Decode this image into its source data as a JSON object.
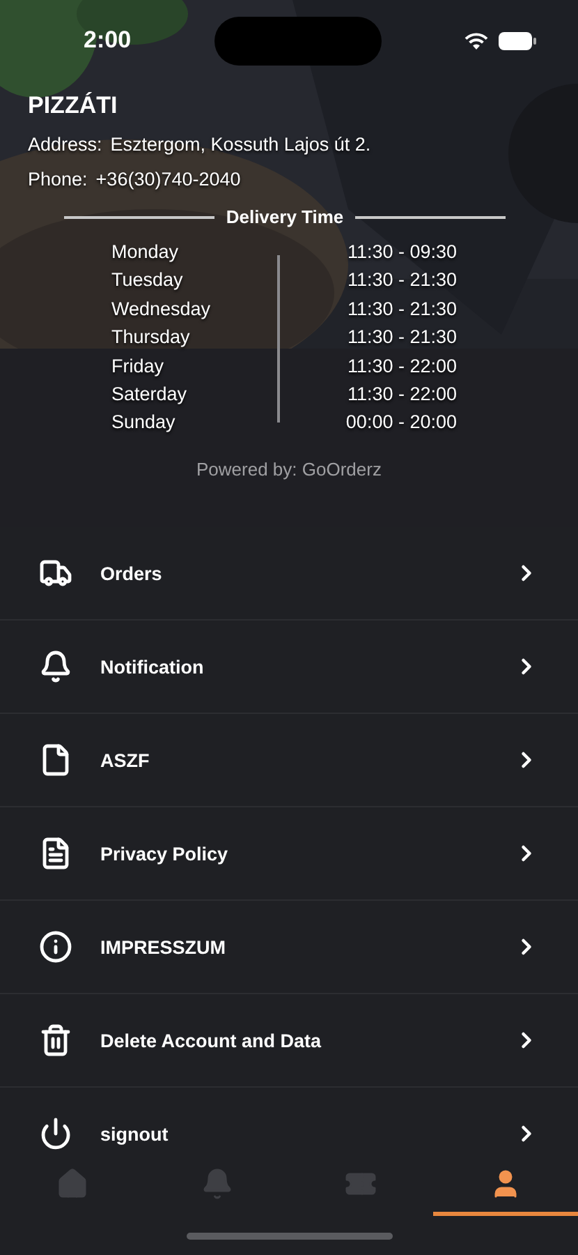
{
  "status_bar": {
    "time": "2:00"
  },
  "restaurant": {
    "name": "PIZZÁTI",
    "address_label": "Address:",
    "address": "Esztergom, Kossuth Lajos út 2.",
    "phone_label": "Phone:",
    "phone": "+36(30)740-2040"
  },
  "delivery": {
    "title": "Delivery Time",
    "days": [
      {
        "day": "Monday",
        "hours": "11:30 - 09:30"
      },
      {
        "day": "Tuesday",
        "hours": "11:30 - 21:30"
      },
      {
        "day": "Wednesday",
        "hours": "11:30 - 21:30"
      },
      {
        "day": "Thursday",
        "hours": "11:30 - 21:30"
      },
      {
        "day": "Friday",
        "hours": "11:30 - 22:00"
      },
      {
        "day": "Saterday",
        "hours": "11:30 - 22:00"
      },
      {
        "day": "Sunday",
        "hours": "00:00 - 20:00"
      }
    ]
  },
  "powered_by": "Powered by: GoOrderz",
  "menu": [
    {
      "kind": "orders",
      "label": "Orders"
    },
    {
      "kind": "notification",
      "label": "Notification"
    },
    {
      "kind": "terms",
      "label": "ASZF"
    },
    {
      "kind": "privacy",
      "label": "Privacy Policy"
    },
    {
      "kind": "info",
      "label": "IMPRESSZUM"
    },
    {
      "kind": "delete",
      "label": "Delete Account and Data"
    },
    {
      "kind": "signout",
      "label": "signout"
    }
  ],
  "tabs": [
    {
      "kind": "home",
      "selected": false
    },
    {
      "kind": "notifications",
      "selected": false
    },
    {
      "kind": "tickets",
      "selected": false
    },
    {
      "kind": "profile",
      "selected": true
    }
  ]
}
